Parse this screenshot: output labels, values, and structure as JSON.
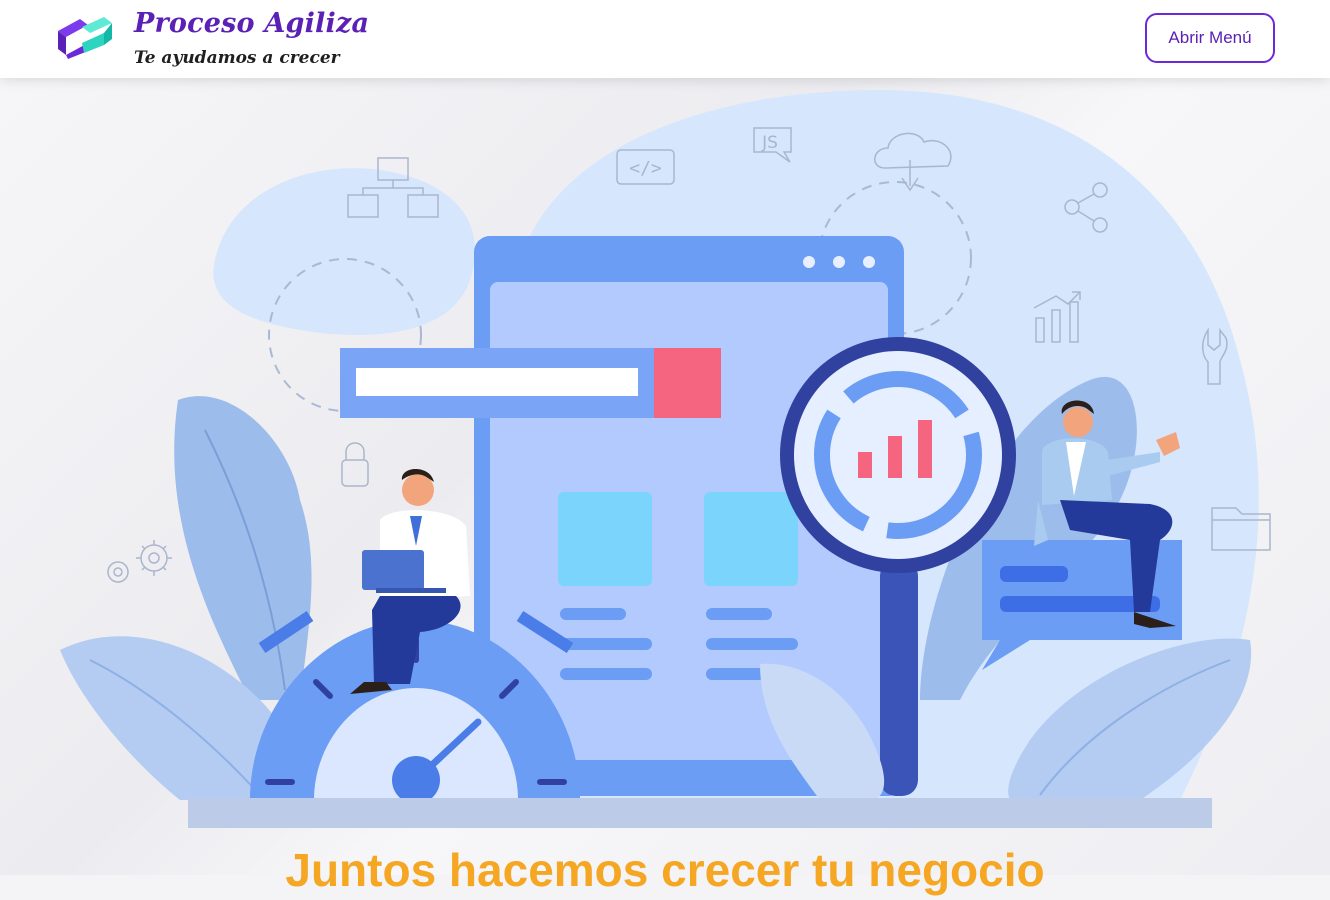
{
  "header": {
    "brand_title": "Proceso Agiliza",
    "brand_tagline": "Te ayudamos a crecer",
    "menu_button_label": "Abrir Menú"
  },
  "hero": {
    "heading": "Juntos hacemos crecer tu negocio",
    "illustration_code_label": "</>",
    "illustration_js_label": "JS"
  },
  "colors": {
    "brand_purple": "#5b21b6",
    "brand_teal": "#2dd4bf",
    "heading_orange": "#f5a623",
    "illustration_blue": "#6b9df5",
    "accent_pink": "#f5657f"
  }
}
